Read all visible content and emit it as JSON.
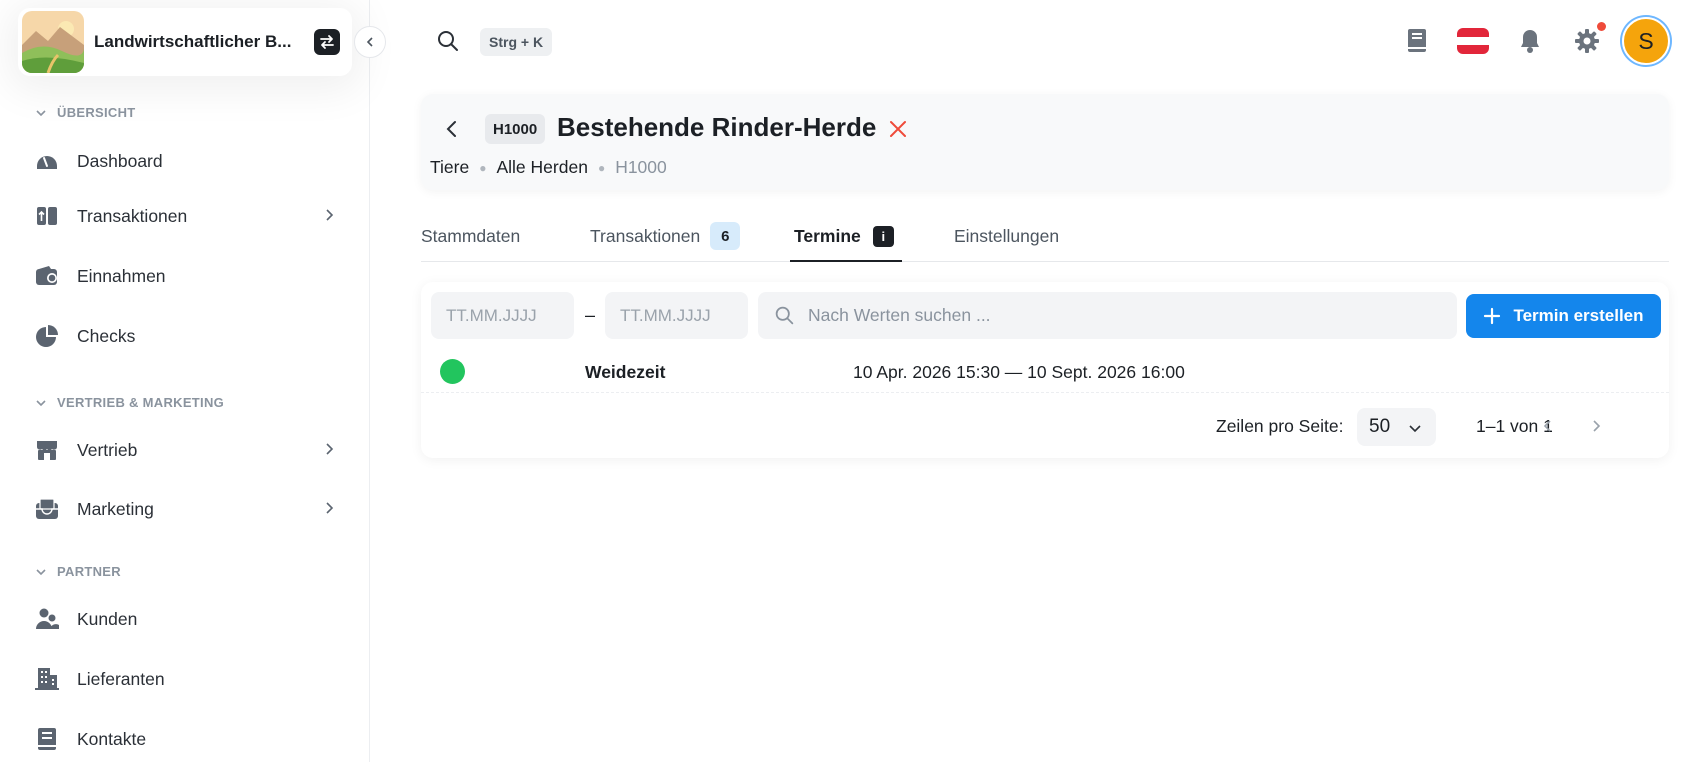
{
  "sidebar": {
    "org_name": "Landwirtschaftlicher B...",
    "sections": [
      {
        "label": "ÜBERSICHT"
      },
      {
        "label": "VERTRIEB & MARKETING"
      },
      {
        "label": "PARTNER"
      }
    ],
    "items": [
      {
        "label": "Dashboard",
        "icon": "gauge-icon"
      },
      {
        "label": "Transaktionen",
        "icon": "transfer-icon",
        "has_children": true
      },
      {
        "label": "Einnahmen",
        "icon": "wallet-icon"
      },
      {
        "label": "Checks",
        "icon": "pie-chart-icon"
      },
      {
        "label": "Vertrieb",
        "icon": "store-icon",
        "has_children": true
      },
      {
        "label": "Marketing",
        "icon": "inbox-mail-icon",
        "has_children": true
      },
      {
        "label": "Kunden",
        "icon": "users-icon"
      },
      {
        "label": "Lieferanten",
        "icon": "building-icon"
      },
      {
        "label": "Kontakte",
        "icon": "contacts-book-icon"
      }
    ]
  },
  "topbar": {
    "shortcut": "Strg + K",
    "avatar_initial": "S",
    "accent_color": "#1486ec",
    "avatar_color": "#f5a40c"
  },
  "header": {
    "code": "H1000",
    "title": "Bestehende Rinder-Herde",
    "breadcrumb": [
      "Tiere",
      "Alle Herden",
      "H1000"
    ]
  },
  "tabs": [
    {
      "label": "Stammdaten"
    },
    {
      "label": "Transaktionen",
      "badge": "6"
    },
    {
      "label": "Termine",
      "badge": "i",
      "active": true
    },
    {
      "label": "Einstellungen"
    }
  ],
  "filters": {
    "from_placeholder": "TT.MM.JJJJ",
    "to_placeholder": "TT.MM.JJJJ",
    "separator": "–",
    "search_placeholder": "Nach Werten suchen ...",
    "create_label": "Termin erstellen"
  },
  "appointments": [
    {
      "title": "Weidezeit",
      "range": "10 Apr. 2026 15:30 — 10 Sept. 2026 16:00",
      "status_color": "#22c55e"
    }
  ],
  "pagination": {
    "rows_label": "Zeilen pro Seite:",
    "rows_value": "50",
    "range": "1–1 von 1"
  }
}
